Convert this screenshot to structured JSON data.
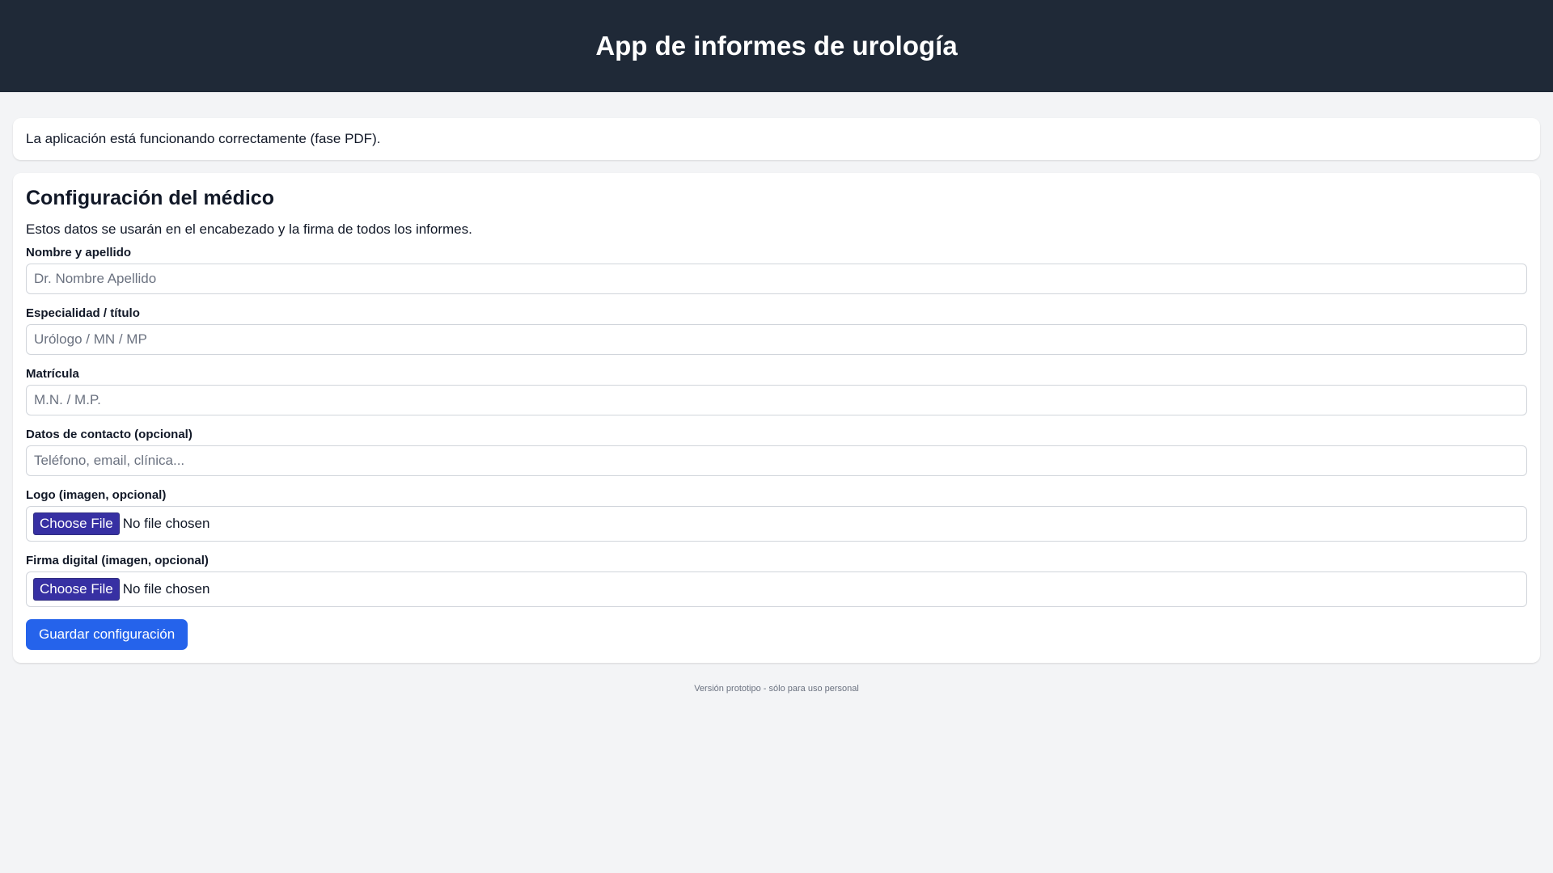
{
  "header": {
    "title": "App de informes de urología"
  },
  "status": {
    "message": "La aplicación está funcionando correctamente (fase PDF)."
  },
  "config": {
    "title": "Configuración del médico",
    "description": "Estos datos se usarán en el encabezado y la firma de todos los informes.",
    "fields": [
      {
        "label": "Nombre y apellido",
        "placeholder": "Dr. Nombre Apellido",
        "value": ""
      },
      {
        "label": "Especialidad / título",
        "placeholder": "Urólogo / MN / MP",
        "value": ""
      },
      {
        "label": "Matrícula",
        "placeholder": "M.N. / M.P.",
        "value": ""
      },
      {
        "label": "Datos de contacto (opcional)",
        "placeholder": "Teléfono, email, clínica...",
        "value": ""
      }
    ],
    "files": [
      {
        "label": "Logo (imagen, opcional)",
        "button": "Choose File",
        "status": "No file chosen"
      },
      {
        "label": "Firma digital (imagen, opcional)",
        "button": "Choose File",
        "status": "No file chosen"
      }
    ],
    "save_label": "Guardar configuración"
  },
  "footer": {
    "text": "Versión prototipo - sólo para uso personal"
  }
}
